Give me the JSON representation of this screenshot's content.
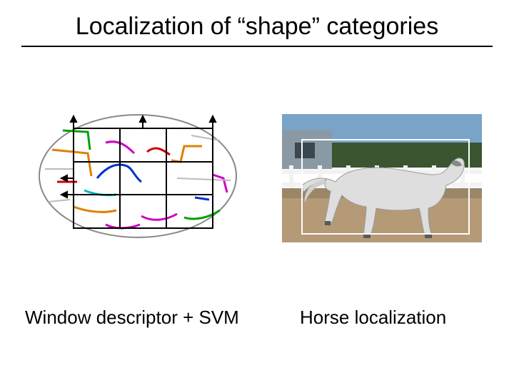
{
  "title": "Localization of “shape” categories",
  "captions": {
    "left": "Window descriptor + SVM",
    "right": "Horse localization"
  }
}
